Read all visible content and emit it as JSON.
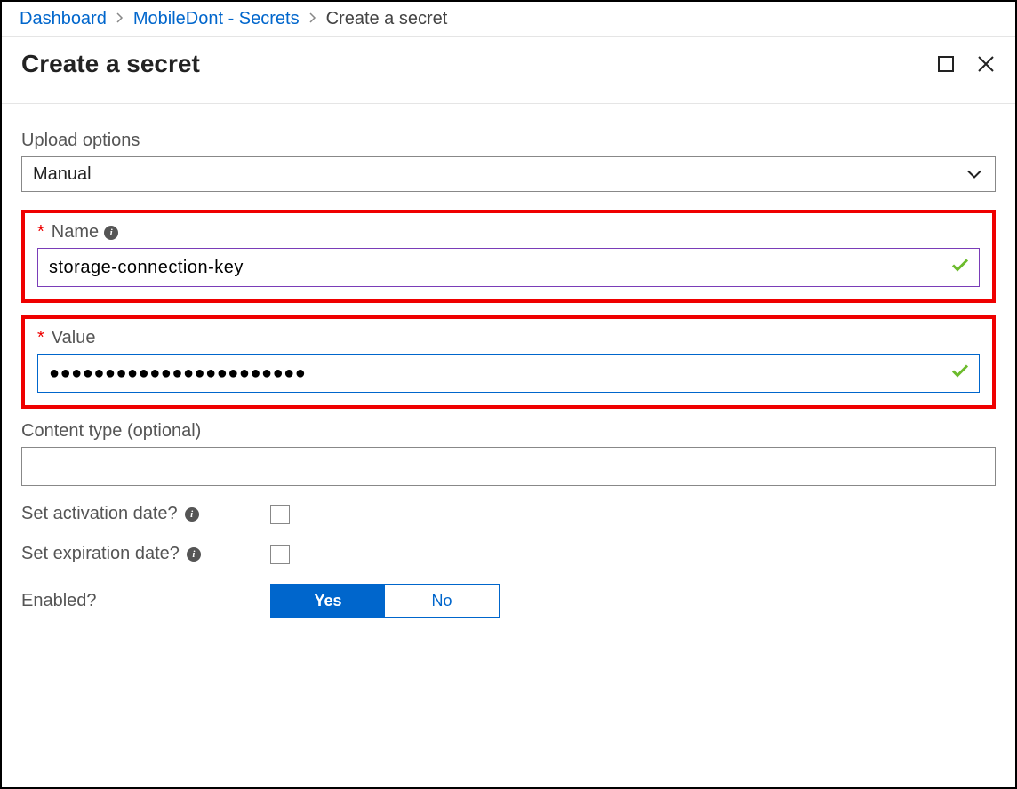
{
  "breadcrumb": {
    "dashboard": "Dashboard",
    "keyvault": "MobileDont - Secrets",
    "current": "Create a secret"
  },
  "header": {
    "title": "Create a secret"
  },
  "form": {
    "uploadOptions": {
      "label": "Upload options",
      "value": "Manual"
    },
    "name": {
      "label": "Name",
      "value": "storage-connection-key"
    },
    "value": {
      "label": "Value",
      "value": "●●●●●●●●●●●●●●●●●●●●●●●"
    },
    "contentType": {
      "label": "Content type (optional)",
      "value": ""
    },
    "activation": {
      "label": "Set activation date?"
    },
    "expiration": {
      "label": "Set expiration date?"
    },
    "enabled": {
      "label": "Enabled?",
      "yes": "Yes",
      "no": "No"
    }
  }
}
